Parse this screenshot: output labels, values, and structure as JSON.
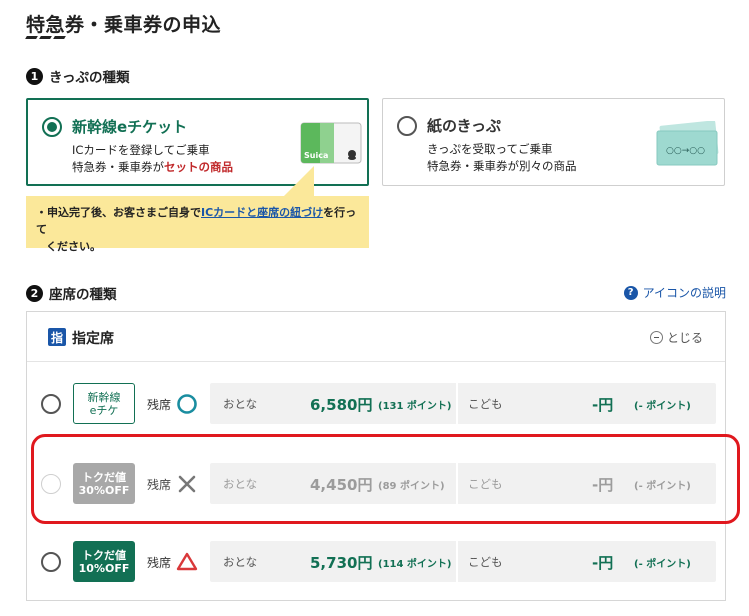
{
  "page": {
    "title": "特急券・乗車券の申込"
  },
  "ticket_type": {
    "step": "1",
    "label": "きっぷの種類",
    "options": [
      {
        "title": "新幹線eチケット",
        "desc_line1": "ICカードを登録してご乗車",
        "desc_line2_a": "特急券・乗車券が",
        "desc_line2_b": "セットの商品",
        "card_text": "Suica",
        "selected": true
      },
      {
        "title": "紙のきっぷ",
        "desc_line1": "きっぷを受取ってご乗車",
        "desc_line2": "特急券・乗車券が別々の商品",
        "ticket_text": "○○→○○",
        "selected": false
      }
    ],
    "note": {
      "prefix": "・申込完了後、お客さまご自身で",
      "link": "ICカードと座席の紐づけ",
      "suffix_line1": "を行って",
      "line2": "ください。"
    }
  },
  "seat_type": {
    "step": "2",
    "label": "座席の種類",
    "help_link": "アイコンの説明",
    "panel": {
      "kanji": "指",
      "title": "指定席",
      "close_label": "とじる"
    },
    "rows": [
      {
        "badge_line1": "新幹線",
        "badge_line2": "eチケ",
        "badge_style": "outline",
        "avail_label": "残席",
        "availability": "circle",
        "adult_label": "おとな",
        "adult_price": "6,580円",
        "adult_points": "(131 ポイント)",
        "child_label": "こども",
        "child_price": "-円",
        "child_points": "(- ポイント)",
        "enabled": true
      },
      {
        "badge_line1": "トクだ値",
        "badge_line2": "30%OFF",
        "badge_style": "gray",
        "avail_label": "残席",
        "availability": "cross",
        "adult_label": "おとな",
        "adult_price": "4,450円",
        "adult_points": "(89 ポイント)",
        "child_label": "こども",
        "child_price": "-円",
        "child_points": "(- ポイント)",
        "enabled": false
      },
      {
        "badge_line1": "トクだ値",
        "badge_line2": "10%OFF",
        "badge_style": "green",
        "avail_label": "残席",
        "availability": "triangle",
        "adult_label": "おとな",
        "adult_price": "5,730円",
        "adult_points": "(114 ポイント)",
        "child_label": "こども",
        "child_price": "-円",
        "child_points": "(- ポイント)",
        "enabled": true
      }
    ]
  },
  "colors": {
    "brand_green": "#127054",
    "link_blue": "#1a56a8",
    "note_yellow": "#fbe89a",
    "accent_red": "#c0282a",
    "highlight_red": "#e0181e",
    "availability_circle": "#1a8da0",
    "availability_cross": "#777777",
    "availability_triangle": "#d9383a"
  }
}
